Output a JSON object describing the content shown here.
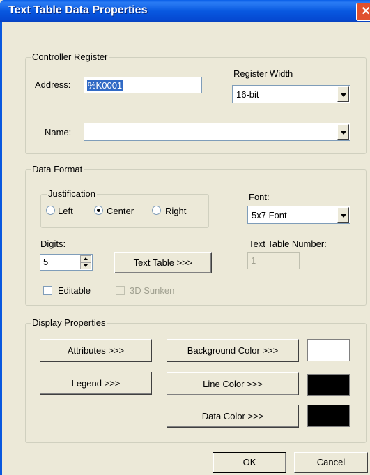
{
  "window": {
    "title": "Text Table Data Properties",
    "close_glyph": "✕"
  },
  "controller_register": {
    "legend": "Controller Register",
    "address_label": "Address:",
    "address_value": "%K0001",
    "register_width_label": "Register Width",
    "register_width_value": "16-bit",
    "name_label": "Name:",
    "name_value": ""
  },
  "data_format": {
    "legend": "Data Format",
    "justification_legend": "Justification",
    "justification_options": [
      "Left",
      "Center",
      "Right"
    ],
    "justification_selected": "Center",
    "font_label": "Font:",
    "font_value": "5x7 Font",
    "digits_label": "Digits:",
    "digits_value": "5",
    "text_table_button": "Text Table >>>",
    "text_table_number_label": "Text Table Number:",
    "text_table_number_value": "1",
    "editable_label": "Editable",
    "sunken_label": "3D Sunken"
  },
  "display_properties": {
    "legend": "Display Properties",
    "attributes_button": "Attributes >>>",
    "legend_button": "Legend >>>",
    "background_color_button": "Background Color >>>",
    "line_color_button": "Line Color >>>",
    "data_color_button": "Data Color >>>",
    "background_color": "#ffffff",
    "line_color": "#000000",
    "data_color": "#000000"
  },
  "footer": {
    "ok_label": "OK",
    "cancel_label": "Cancel"
  }
}
